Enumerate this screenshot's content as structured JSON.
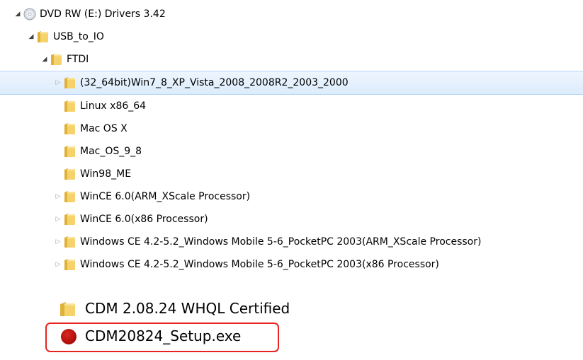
{
  "tree": {
    "items": [
      {
        "label": "DVD RW (E:) Drivers 3.42",
        "icon": "dvd-drive-icon",
        "level": 0,
        "expander": "expanded"
      },
      {
        "label": "USB_to_IO",
        "icon": "folder-icon",
        "level": 1,
        "expander": "expanded"
      },
      {
        "label": "FTDI",
        "icon": "folder-icon",
        "level": 2,
        "expander": "expanded"
      },
      {
        "label": "(32_64bit)Win7_8_XP_Vista_2008_2008R2_2003_2000",
        "icon": "folder-icon",
        "level": 3,
        "expander": "collapsed",
        "selected": true
      },
      {
        "label": "Linux x86_64",
        "icon": "folder-icon",
        "level": 3,
        "expander": "none"
      },
      {
        "label": "Mac OS X",
        "icon": "folder-icon",
        "level": 3,
        "expander": "none"
      },
      {
        "label": "Mac_OS_9_8",
        "icon": "folder-icon",
        "level": 3,
        "expander": "none"
      },
      {
        "label": "Win98_ME",
        "icon": "folder-icon",
        "level": 3,
        "expander": "none"
      },
      {
        "label": "WinCE 6.0(ARM_XScale Processor)",
        "icon": "folder-icon",
        "level": 3,
        "expander": "collapsed"
      },
      {
        "label": "WinCE 6.0(x86 Processor)",
        "icon": "folder-icon",
        "level": 3,
        "expander": "collapsed"
      },
      {
        "label": "Windows CE 4.2-5.2_Windows Mobile 5-6_PocketPC 2003(ARM_XScale Processor)",
        "icon": "folder-icon",
        "level": 3,
        "expander": "collapsed"
      },
      {
        "label": "Windows CE 4.2-5.2_Windows Mobile 5-6_PocketPC 2003(x86 Processor)",
        "icon": "folder-icon",
        "level": 3,
        "expander": "collapsed"
      }
    ]
  },
  "files": {
    "folder_label": "CDM 2.08.24 WHQL Certified",
    "folder_icon": "folder-icon",
    "setup_label": "CDM20824_Setup.exe",
    "setup_icon": "installer-icon",
    "highlight_color": "#e8231f"
  },
  "colors": {
    "selection_bg": "#dcecfc",
    "selection_border": "#b3d3f3",
    "folder_yellow": "#f2c94c"
  }
}
